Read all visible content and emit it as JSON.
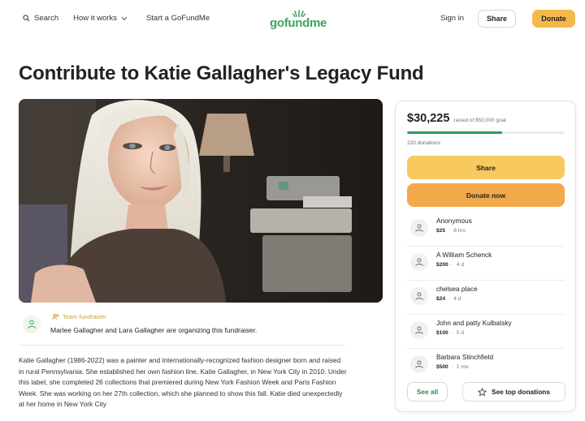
{
  "header": {
    "search_label": "Search",
    "how_it_works_label": "How it works",
    "start_label": "Start a GoFundMe",
    "logo_text": "gofundme",
    "signin_label": "Sign in",
    "share_label": "Share",
    "donate_label": "Donate"
  },
  "page": {
    "title": "Contribute to Katie Gallagher's Legacy Fund"
  },
  "organizer": {
    "badge": "Team fundraiser",
    "text": "Marlee Gallagher and Lara Gallagher are organizing this fundraiser."
  },
  "story": {
    "text": "Katie Gallagher (1986-2022) was a painter and internationally-recognized fashion designer born and raised in rural Pennsylvania. She established her own fashion line, Katie Gallagher, in New York City in 2010. Under this label, she completed 26 collections that premiered during New York Fashion Week and Paris Fashion Week. She was working on her 27th collection, which she planned to show this fall. Katie died unexpectedly at her home in New York City"
  },
  "sidebar": {
    "raised": "$30,225",
    "goal_text": "raised of $50,000 goal",
    "progress_fraction": 0.6045,
    "donations_count": "220 donations",
    "share_label": "Share",
    "donate_label": "Donate now",
    "donors": [
      {
        "name": "Anonymous",
        "amount": "$25",
        "time": "8 hrs"
      },
      {
        "name": "A William Schenck",
        "amount": "$200",
        "time": "4 d"
      },
      {
        "name": "chelsea place",
        "amount": "$24",
        "time": "4 d"
      },
      {
        "name": "John and patty Kulbatsky",
        "amount": "$100",
        "time": "5 d"
      },
      {
        "name": "Barbara Stinchfield",
        "amount": "$500",
        "time": "1 mo"
      }
    ],
    "see_all_label": "See all",
    "see_top_label": "See top donations"
  },
  "colors": {
    "brand_green": "#2f9e57",
    "donate_orange": "#f2a94a",
    "share_yellow": "#f7c95e"
  }
}
